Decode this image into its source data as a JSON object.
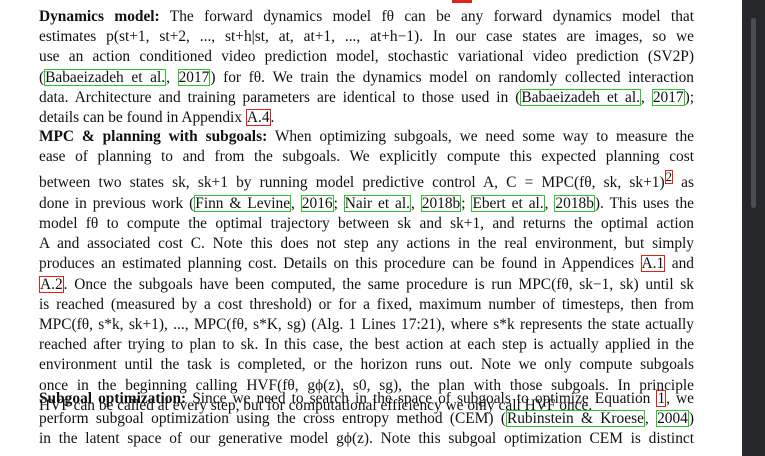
{
  "p1": {
    "heading": "Dynamics model:",
    "l1": "The forward dynamics model fθ can be any forward dynamics model that",
    "l2": "estimates p(st+1, st+2, ..., st+h|st, at, at+1, ..., at+h−1).  In our case states are images, so we",
    "l3": "use an action conditioned video prediction model, stochastic variational video prediction (SV2P)",
    "l4a": "(",
    "ref1": "Babaeizadeh et al.",
    "sep1": ", ",
    "ref1y": "2017",
    "l4b": ") for fθ. We train the dynamics model on randomly collected interaction",
    "l5a": "data. Architecture and training parameters are identical to those used in (",
    "ref2": "Babaeizadeh et al.",
    "sep2": ", ",
    "ref2y": "2017",
    "l5b": ");",
    "l6a": "details can be found in Appendix ",
    "ref3": "A.4",
    "l6b": "."
  },
  "p2": {
    "heading": "MPC & planning with subgoals:",
    "l1": "When optimizing subgoals, we need some way to measure the",
    "l2": "ease of planning to and from the subgoals.  We explicitly compute this expected planning cost",
    "l3a": "between two states sk, sk+1 by running model predictive control A, C = MPC(fθ, sk, sk+1)",
    "fn": "2",
    "l3b": " as",
    "l4a": "done in previous work (",
    "r1": "Finn & Levine",
    "s1": ", ",
    "r1y": "2016",
    "s2": "; ",
    "r2": "Nair et al.",
    "s3": ", ",
    "r2y": "2018b",
    "s4": "; ",
    "r3": "Ebert et al.",
    "s5": ", ",
    "r3y": "2018b",
    "l4b": "). This uses the",
    "l5": "model fθ to compute the optimal trajectory between sk and sk+1, and returns the optimal action",
    "l6": "A and associated cost C.  Note this does not step any actions in the real environment, but simply",
    "l7a": "produces an estimated planning cost. Details on this procedure can be found in Appendices ",
    "r4": "A.1",
    "l7b": " and",
    "l8a": "",
    "r5": "A.2",
    "l8b": ". Once the subgoals have been computed, the same procedure is run MPC(fθ, sk−1, sk) until sk",
    "l9": "is reached (measured by a cost threshold) or for a fixed, maximum number of timesteps, then from",
    "l10": "MPC(fθ, s*k, sk+1), ..., MPC(fθ, s*K, sg) (Alg. 1 Lines 17:21), where s*k represents the state actually",
    "l11": "reached after trying to plan to sk. In this case, the best action at each step is actually applied in the",
    "l12": "environment until the task is completed, or the horizon runs out.  Note we only compute subgoals",
    "l13": "once in the beginning calling HVF(fθ, gϕ(z), s0, sg), the plan with those subgoals.  In principle",
    "l14": "HVF can be called at every step, but for computational efficiency we only call HVF once."
  },
  "p3": {
    "heading": "Subgoal optimization:",
    "l1a": "Since we need to search in the space of subgoals to optimize Equation ",
    "r1": "1",
    "l1b": ", we",
    "l2a": "perform subgoal optimization using the cross entropy method (CEM) (",
    "r2": "Rubinstein & Kroese",
    "s1": ", ",
    "r2y": "2004",
    "l2b": ")",
    "l3": "in the latent space of our generative model gϕ(z).  Note this subgoal optimization CEM is distinct"
  }
}
